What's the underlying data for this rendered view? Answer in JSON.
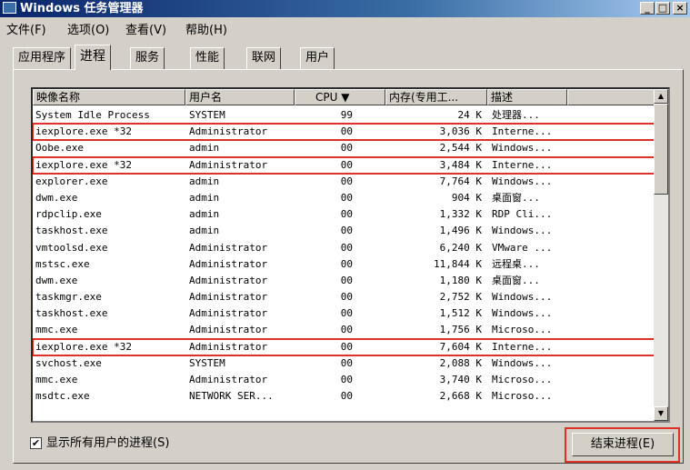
{
  "window": {
    "title": "Windows 任务管理器",
    "controls": [
      "_",
      "□",
      "×"
    ]
  },
  "menu": [
    "文件(F)",
    "选项(O)",
    "查看(V)",
    "帮助(H)"
  ],
  "tabs": [
    "应用程序",
    "进程",
    "服务",
    "性能",
    "联网",
    "用户"
  ],
  "active_tab": "进程",
  "columns": [
    "映像名称",
    "用户名",
    "CPU ▼",
    "内存(专用工...",
    "描述"
  ],
  "processes": [
    {
      "name": "System Idle Process",
      "user": "SYSTEM",
      "cpu": "99",
      "mem": "24 K",
      "desc": "处理器...",
      "highlight": false
    },
    {
      "name": "iexplore.exe *32",
      "user": "Administrator",
      "cpu": "00",
      "mem": "3,036 K",
      "desc": "Interne...",
      "highlight": true
    },
    {
      "name": "Oobe.exe",
      "user": "admin",
      "cpu": "00",
      "mem": "2,544 K",
      "desc": "Windows...",
      "highlight": false
    },
    {
      "name": "iexplore.exe *32",
      "user": "Administrator",
      "cpu": "00",
      "mem": "3,484 K",
      "desc": "Interne...",
      "highlight": true
    },
    {
      "name": "explorer.exe",
      "user": "admin",
      "cpu": "00",
      "mem": "7,764 K",
      "desc": "Windows...",
      "highlight": false
    },
    {
      "name": "dwm.exe",
      "user": "admin",
      "cpu": "00",
      "mem": "904 K",
      "desc": "桌面窗...",
      "highlight": false
    },
    {
      "name": "rdpclip.exe",
      "user": "admin",
      "cpu": "00",
      "mem": "1,332 K",
      "desc": "RDP Cli...",
      "highlight": false
    },
    {
      "name": "taskhost.exe",
      "user": "admin",
      "cpu": "00",
      "mem": "1,496 K",
      "desc": "Windows...",
      "highlight": false
    },
    {
      "name": "vmtoolsd.exe",
      "user": "Administrator",
      "cpu": "00",
      "mem": "6,240 K",
      "desc": "VMware ...",
      "highlight": false
    },
    {
      "name": "mstsc.exe",
      "user": "Administrator",
      "cpu": "00",
      "mem": "11,844 K",
      "desc": "远程桌...",
      "highlight": false
    },
    {
      "name": "dwm.exe",
      "user": "Administrator",
      "cpu": "00",
      "mem": "1,180 K",
      "desc": "桌面窗...",
      "highlight": false
    },
    {
      "name": "taskmgr.exe",
      "user": "Administrator",
      "cpu": "00",
      "mem": "2,752 K",
      "desc": "Windows...",
      "highlight": false
    },
    {
      "name": "taskhost.exe",
      "user": "Administrator",
      "cpu": "00",
      "mem": "1,512 K",
      "desc": "Windows...",
      "highlight": false
    },
    {
      "name": "mmc.exe",
      "user": "Administrator",
      "cpu": "00",
      "mem": "1,756 K",
      "desc": "Microso...",
      "highlight": false
    },
    {
      "name": "iexplore.exe *32",
      "user": "Administrator",
      "cpu": "00",
      "mem": "7,604 K",
      "desc": "Interne...",
      "highlight": true
    },
    {
      "name": "svchost.exe",
      "user": "SYSTEM",
      "cpu": "00",
      "mem": "2,088 K",
      "desc": "Windows...",
      "highlight": false
    },
    {
      "name": "mmc.exe",
      "user": "Administrator",
      "cpu": "00",
      "mem": "3,740 K",
      "desc": "Microso...",
      "highlight": false
    },
    {
      "name": "msdtc.exe",
      "user": "NETWORK SER...",
      "cpu": "00",
      "mem": "2,668 K",
      "desc": "Microso...",
      "highlight": false
    }
  ],
  "show_all_users": {
    "label": "显示所有用户的进程(S)",
    "checked": "✔"
  },
  "end_process_button": "结束进程(E)",
  "highlight_color": "#e0302a"
}
